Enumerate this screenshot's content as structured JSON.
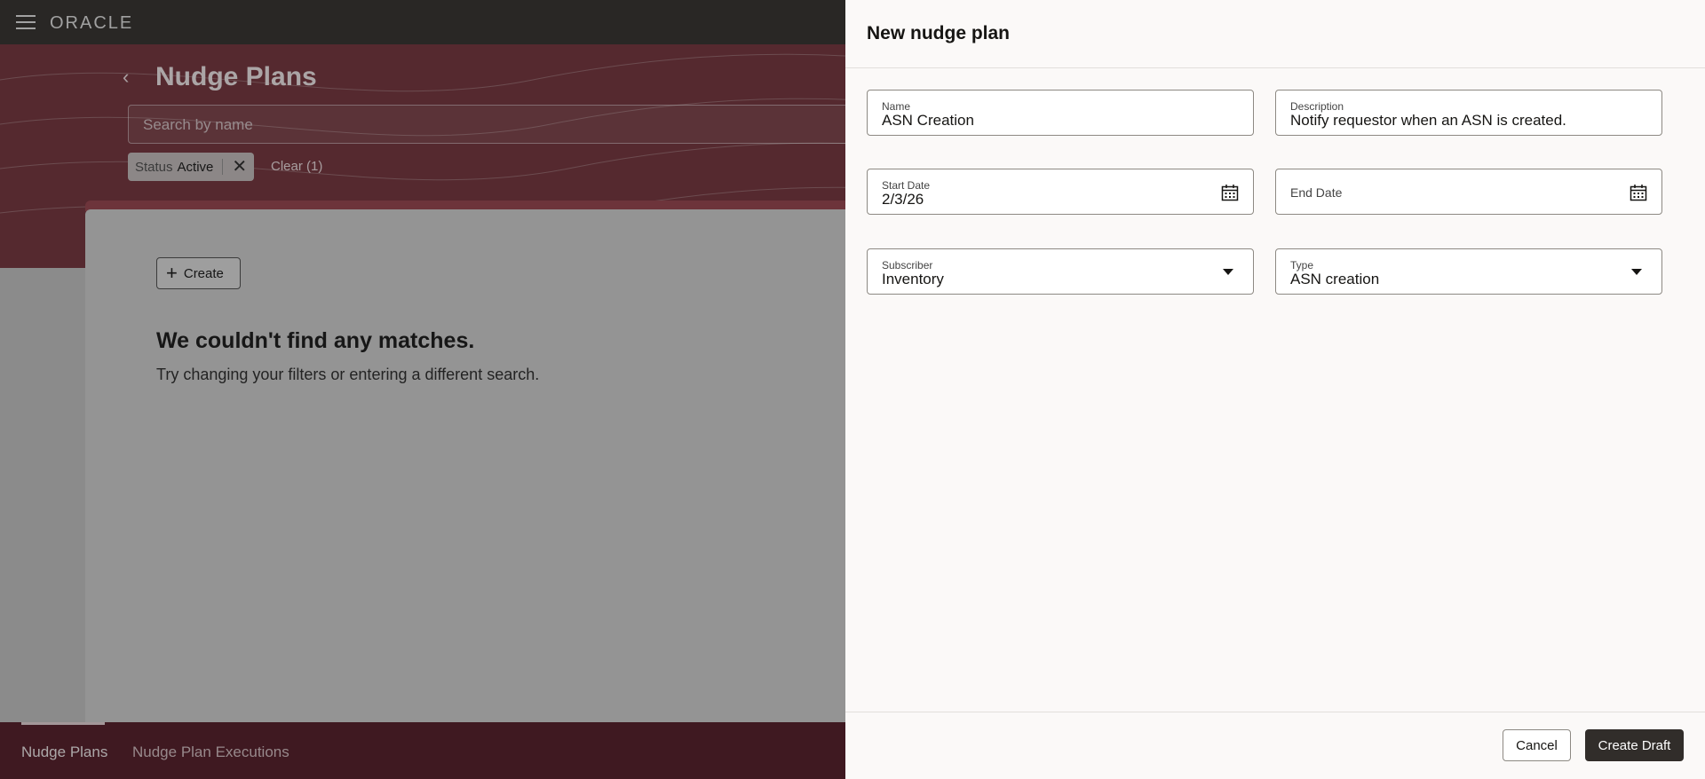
{
  "app": {
    "logo": "ORACLE"
  },
  "page": {
    "title": "Nudge Plans",
    "search_placeholder": "Search by name",
    "filter_chip": {
      "key": "Status",
      "value": "Active"
    },
    "clear_label": "Clear (1)",
    "create_label": "Create",
    "empty_title": "We couldn't find any matches.",
    "empty_subtitle": "Try changing your filters or entering a different search."
  },
  "bottom_nav": {
    "items": [
      {
        "label": "Nudge Plans",
        "active": true
      },
      {
        "label": "Nudge Plan Executions",
        "active": false
      }
    ]
  },
  "drawer": {
    "title": "New nudge plan",
    "fields": {
      "name": {
        "label": "Name",
        "value": "ASN Creation"
      },
      "description": {
        "label": "Description",
        "value": "Notify requestor when an ASN is created."
      },
      "start_date": {
        "label": "Start Date",
        "value": "2/3/26"
      },
      "end_date": {
        "label": "End Date",
        "value": ""
      },
      "subscriber": {
        "label": "Subscriber",
        "value": "Inventory"
      },
      "type": {
        "label": "Type",
        "value": "ASN creation"
      }
    },
    "cancel_label": "Cancel",
    "create_draft_label": "Create Draft"
  },
  "colors": {
    "topbar": "#3b3936",
    "hero": "#7a3c44",
    "bottom_nav": "#5b2530",
    "primary_button": "#312d2a"
  }
}
